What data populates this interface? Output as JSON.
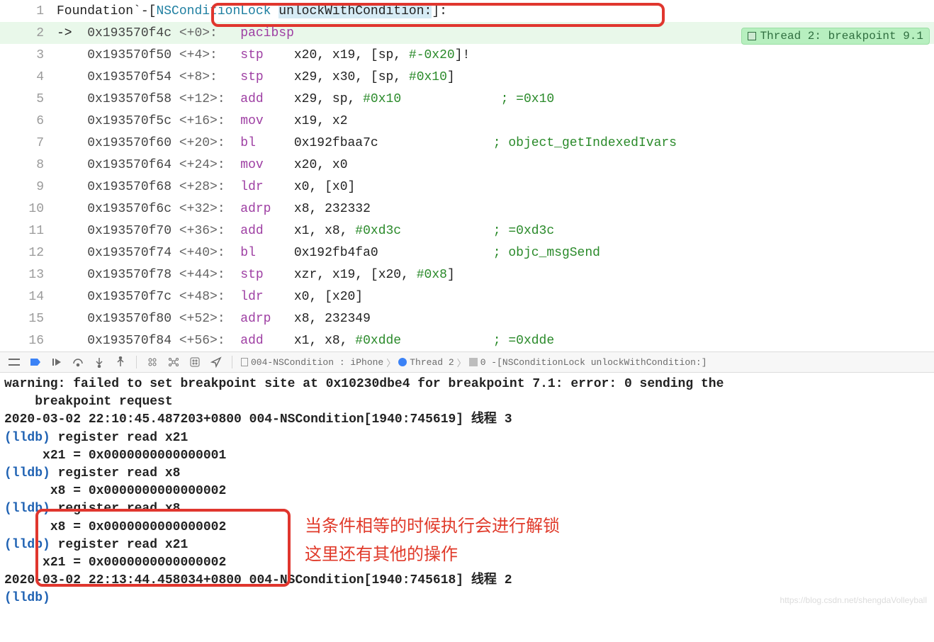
{
  "header": {
    "prefix": "Foundation`",
    "method": "-[NSConditionLock unlockWithCondition:]",
    "suffix": ":",
    "highlighted_part": "unlockWithCondition:"
  },
  "breakpoint_badge": "Thread 2: breakpoint 9.1",
  "arrow": "->",
  "lines": [
    {
      "n": 1,
      "segs": [
        {
          "t": "Foundation`",
          "c": "c-txt"
        },
        {
          "t": "-[",
          "c": "c-txt"
        },
        {
          "t": "NSConditionLock ",
          "c": "c-type"
        },
        {
          "t": "unlockWithCondition:",
          "c": "c-txt hl"
        },
        {
          "t": "]:",
          "c": "c-txt"
        }
      ]
    },
    {
      "n": 2,
      "hl": true,
      "arrow": true,
      "segs": [
        {
          "t": "0x193570f4c",
          "c": "c-addr"
        },
        {
          "t": " <+0>:   ",
          "c": "c-off"
        },
        {
          "t": "pacibsp",
          "c": "c-op"
        }
      ]
    },
    {
      "n": 3,
      "segs": [
        {
          "t": "0x193570f50",
          "c": "c-addr"
        },
        {
          "t": " <+4>:   ",
          "c": "c-off"
        },
        {
          "t": "stp",
          "c": "c-op"
        },
        {
          "t": "    x20, x19, [sp, ",
          "c": "c-txt"
        },
        {
          "t": "#-0x20",
          "c": "c-imm"
        },
        {
          "t": "]!",
          "c": "c-txt"
        }
      ]
    },
    {
      "n": 4,
      "segs": [
        {
          "t": "0x193570f54",
          "c": "c-addr"
        },
        {
          "t": " <+8>:   ",
          "c": "c-off"
        },
        {
          "t": "stp",
          "c": "c-op"
        },
        {
          "t": "    x29, x30, [sp, ",
          "c": "c-txt"
        },
        {
          "t": "#0x10",
          "c": "c-imm"
        },
        {
          "t": "]",
          "c": "c-txt"
        }
      ]
    },
    {
      "n": 5,
      "segs": [
        {
          "t": "0x193570f58",
          "c": "c-addr"
        },
        {
          "t": " <+12>:  ",
          "c": "c-off"
        },
        {
          "t": "add",
          "c": "c-op"
        },
        {
          "t": "    x29, sp, ",
          "c": "c-txt"
        },
        {
          "t": "#0x10",
          "c": "c-imm"
        },
        {
          "t": "             ",
          "c": "c-txt"
        },
        {
          "t": "; =0x10",
          "c": "c-cmt"
        }
      ]
    },
    {
      "n": 6,
      "segs": [
        {
          "t": "0x193570f5c",
          "c": "c-addr"
        },
        {
          "t": " <+16>:  ",
          "c": "c-off"
        },
        {
          "t": "mov",
          "c": "c-op"
        },
        {
          "t": "    x19, x2",
          "c": "c-txt"
        }
      ]
    },
    {
      "n": 7,
      "segs": [
        {
          "t": "0x193570f60",
          "c": "c-addr"
        },
        {
          "t": " <+20>:  ",
          "c": "c-off"
        },
        {
          "t": "bl",
          "c": "c-op"
        },
        {
          "t": "     0x192fbaa7c               ",
          "c": "c-txt"
        },
        {
          "t": "; object_getIndexedIvars",
          "c": "c-cmt"
        }
      ]
    },
    {
      "n": 8,
      "segs": [
        {
          "t": "0x193570f64",
          "c": "c-addr"
        },
        {
          "t": " <+24>:  ",
          "c": "c-off"
        },
        {
          "t": "mov",
          "c": "c-op"
        },
        {
          "t": "    x20, x0",
          "c": "c-txt"
        }
      ]
    },
    {
      "n": 9,
      "segs": [
        {
          "t": "0x193570f68",
          "c": "c-addr"
        },
        {
          "t": " <+28>:  ",
          "c": "c-off"
        },
        {
          "t": "ldr",
          "c": "c-op"
        },
        {
          "t": "    x0, [x0]",
          "c": "c-txt"
        }
      ]
    },
    {
      "n": 10,
      "segs": [
        {
          "t": "0x193570f6c",
          "c": "c-addr"
        },
        {
          "t": " <+32>:  ",
          "c": "c-off"
        },
        {
          "t": "adrp",
          "c": "c-op"
        },
        {
          "t": "   x8, 232332",
          "c": "c-txt"
        }
      ]
    },
    {
      "n": 11,
      "segs": [
        {
          "t": "0x193570f70",
          "c": "c-addr"
        },
        {
          "t": " <+36>:  ",
          "c": "c-off"
        },
        {
          "t": "add",
          "c": "c-op"
        },
        {
          "t": "    x1, x8, ",
          "c": "c-txt"
        },
        {
          "t": "#0xd3c",
          "c": "c-imm"
        },
        {
          "t": "            ",
          "c": "c-txt"
        },
        {
          "t": "; =0xd3c",
          "c": "c-cmt"
        }
      ]
    },
    {
      "n": 12,
      "segs": [
        {
          "t": "0x193570f74",
          "c": "c-addr"
        },
        {
          "t": " <+40>:  ",
          "c": "c-off"
        },
        {
          "t": "bl",
          "c": "c-op"
        },
        {
          "t": "     0x192fb4fa0               ",
          "c": "c-txt"
        },
        {
          "t": "; objc_msgSend",
          "c": "c-cmt"
        }
      ]
    },
    {
      "n": 13,
      "segs": [
        {
          "t": "0x193570f78",
          "c": "c-addr"
        },
        {
          "t": " <+44>:  ",
          "c": "c-off"
        },
        {
          "t": "stp",
          "c": "c-op"
        },
        {
          "t": "    xzr, x19, [x20, ",
          "c": "c-txt"
        },
        {
          "t": "#0x8",
          "c": "c-imm"
        },
        {
          "t": "]",
          "c": "c-txt"
        }
      ]
    },
    {
      "n": 14,
      "segs": [
        {
          "t": "0x193570f7c",
          "c": "c-addr"
        },
        {
          "t": " <+48>:  ",
          "c": "c-off"
        },
        {
          "t": "ldr",
          "c": "c-op"
        },
        {
          "t": "    x0, [x20]",
          "c": "c-txt"
        }
      ]
    },
    {
      "n": 15,
      "segs": [
        {
          "t": "0x193570f80",
          "c": "c-addr"
        },
        {
          "t": " <+52>:  ",
          "c": "c-off"
        },
        {
          "t": "adrp",
          "c": "c-op"
        },
        {
          "t": "   x8, 232349",
          "c": "c-txt"
        }
      ]
    },
    {
      "n": 16,
      "segs": [
        {
          "t": "0x193570f84",
          "c": "c-addr"
        },
        {
          "t": " <+56>:  ",
          "c": "c-off"
        },
        {
          "t": "add",
          "c": "c-op"
        },
        {
          "t": "    x1, x8, ",
          "c": "c-txt"
        },
        {
          "t": "#0xdde",
          "c": "c-imm"
        },
        {
          "t": "            ",
          "c": "c-txt"
        },
        {
          "t": "; =0xdde",
          "c": "c-cmt"
        }
      ]
    }
  ],
  "toolbar_breadcrumb": {
    "app": "004-NSCondition : iPhone",
    "thread": "Thread 2",
    "frame": "0 -[NSConditionLock unlockWithCondition:]"
  },
  "console_lines": [
    {
      "segs": [
        {
          "t": "warning: failed to set breakpoint site at 0x10230dbe4 for breakpoint 7.1: error: 0 sending the",
          "c": "bold"
        }
      ]
    },
    {
      "segs": [
        {
          "t": "    breakpoint request",
          "c": "bold"
        }
      ]
    },
    {
      "segs": [
        {
          "t": "2020-03-02 22:10:45.487203+0800 004-NSCondition[1940:745619] 线程 3",
          "c": "bold"
        }
      ]
    },
    {
      "segs": [
        {
          "t": "(lldb)",
          "c": "lldb"
        },
        {
          "t": " register read x21",
          "c": "bold"
        }
      ]
    },
    {
      "segs": [
        {
          "t": "     x21 = 0x0000000000000001",
          "c": "bold"
        }
      ]
    },
    {
      "segs": [
        {
          "t": "(lldb)",
          "c": "lldb"
        },
        {
          "t": " register read x8",
          "c": "bold"
        }
      ]
    },
    {
      "segs": [
        {
          "t": "      x8 = 0x0000000000000002",
          "c": "bold"
        }
      ]
    },
    {
      "segs": [
        {
          "t": "(lldb)",
          "c": "lldb"
        },
        {
          "t": " register read x8",
          "c": "bold"
        }
      ]
    },
    {
      "segs": [
        {
          "t": "      x8 = 0x0000000000000002",
          "c": "bold"
        }
      ]
    },
    {
      "segs": [
        {
          "t": "(lldb)",
          "c": "lldb"
        },
        {
          "t": " register read x21",
          "c": "bold"
        }
      ]
    },
    {
      "segs": [
        {
          "t": "     x21 = 0x0000000000000002",
          "c": "bold"
        }
      ]
    },
    {
      "segs": [
        {
          "t": "2020-03-02 22:13:44.458034+0800 004-NSCondition[1940:745618] 线程 2",
          "c": "bold"
        }
      ]
    },
    {
      "segs": [
        {
          "t": "(lldb)",
          "c": "lldb"
        }
      ]
    }
  ],
  "annotations": {
    "line1": "当条件相等的时候执行会进行解锁",
    "line2": "这里还有其他的操作"
  },
  "watermark": "https://blog.csdn.net/shengdaVolleyball"
}
